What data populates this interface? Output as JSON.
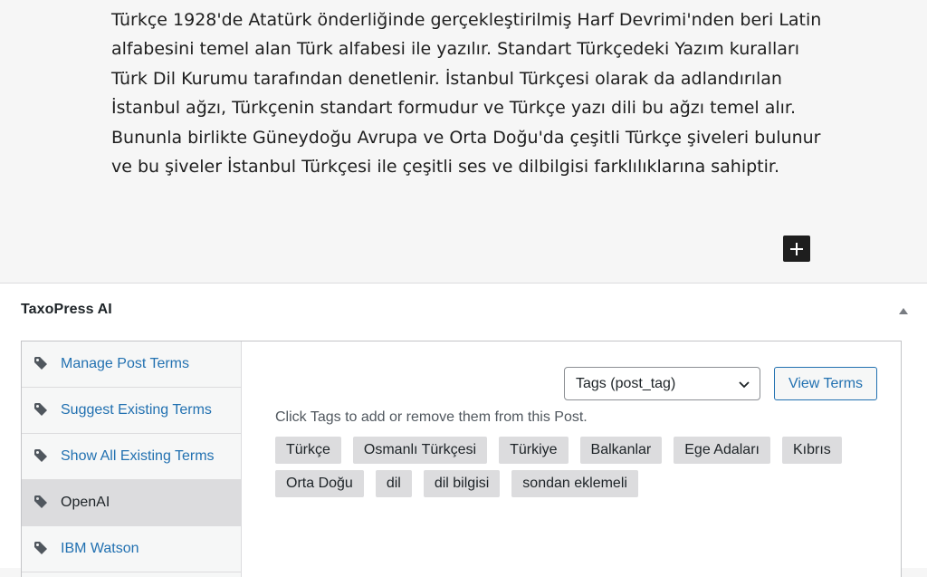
{
  "editor": {
    "paragraph": "Türkçe 1928'de Atatürk önderliğinde gerçekleştirilmiş Harf Devrimi'nden beri Latin alfabesini temel alan Türk alfabesi ile yazılır. Standart Türkçedeki Yazım kuralları Türk Dil Kurumu tarafından denetlenir. İstanbul Türkçesi olarak da adlandırılan İstanbul ağzı, Türkçenin standart formudur ve Türkçe yazı dili bu ağzı temel alır. Bununla birlikte Güneydoğu Avrupa ve Orta Doğu'da çeşitli Türkçe şiveleri bulunur ve bu şiveler İstanbul Türkçesi ile çeşitli ses ve dilbilgisi farklılıklarına sahiptir.",
    "add_block_icon": "plus-icon"
  },
  "panel": {
    "title": "TaxoPress AI",
    "toggle_icon": "triangle-up-icon",
    "nav": [
      {
        "label": "Manage Post Terms",
        "icon": "tag-icon",
        "active": false
      },
      {
        "label": "Suggest Existing Terms",
        "icon": "tag-icon",
        "active": false
      },
      {
        "label": "Show All Existing Terms",
        "icon": "tag-icon",
        "active": false
      },
      {
        "label": "OpenAI",
        "icon": "tag-icon",
        "active": true
      },
      {
        "label": "IBM Watson",
        "icon": "tag-icon",
        "active": false
      }
    ],
    "taxonomy_select": "Tags (post_tag)",
    "view_terms_label": "View Terms",
    "hint": "Click Tags to add or remove them from this Post.",
    "tags": [
      "Türkçe",
      "Osmanlı Türkçesi",
      "Türkiye",
      "Balkanlar",
      "Ege Adaları",
      "Kıbrıs",
      "Orta Doğu",
      "dil",
      "dil bilgisi",
      "sondan eklemeli"
    ]
  },
  "colors": {
    "link": "#2271b1",
    "chip_bg": "#dcdcde",
    "active_nav_bg": "#dcdcde",
    "editor_bg": "#f6f6f6"
  }
}
